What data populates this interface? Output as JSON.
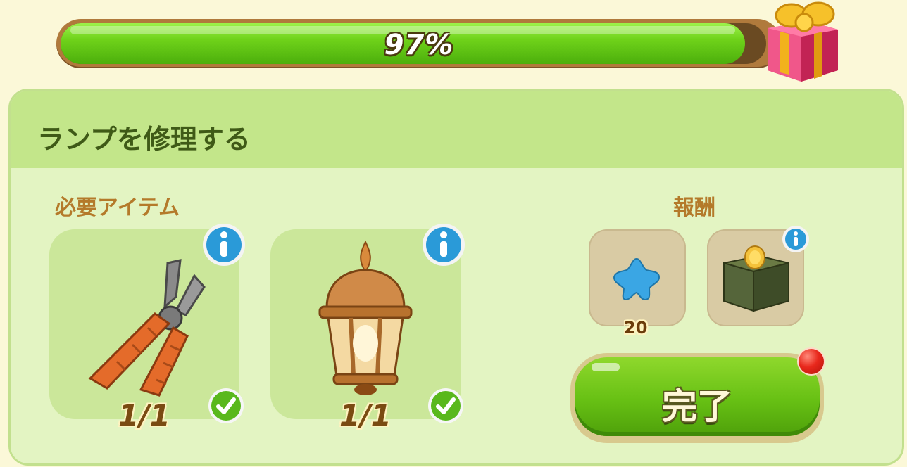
{
  "progress": {
    "percent": 97,
    "label": "97%"
  },
  "task": {
    "title": "ランプを修理する"
  },
  "required": {
    "label": "必要アイテム",
    "items": [
      {
        "icon": "pliers-icon",
        "count": "1/1",
        "complete": true
      },
      {
        "icon": "lantern-icon",
        "count": "1/1",
        "complete": true
      }
    ]
  },
  "rewards": {
    "label": "報酬",
    "items": [
      {
        "icon": "blue-star-icon",
        "count": "20"
      },
      {
        "icon": "coin-box-icon"
      }
    ]
  },
  "complete_button": {
    "label": "完了"
  },
  "colors": {
    "accent_green": "#6fd21a",
    "title_green": "#3f5a17",
    "label_brown": "#b47a2a"
  }
}
